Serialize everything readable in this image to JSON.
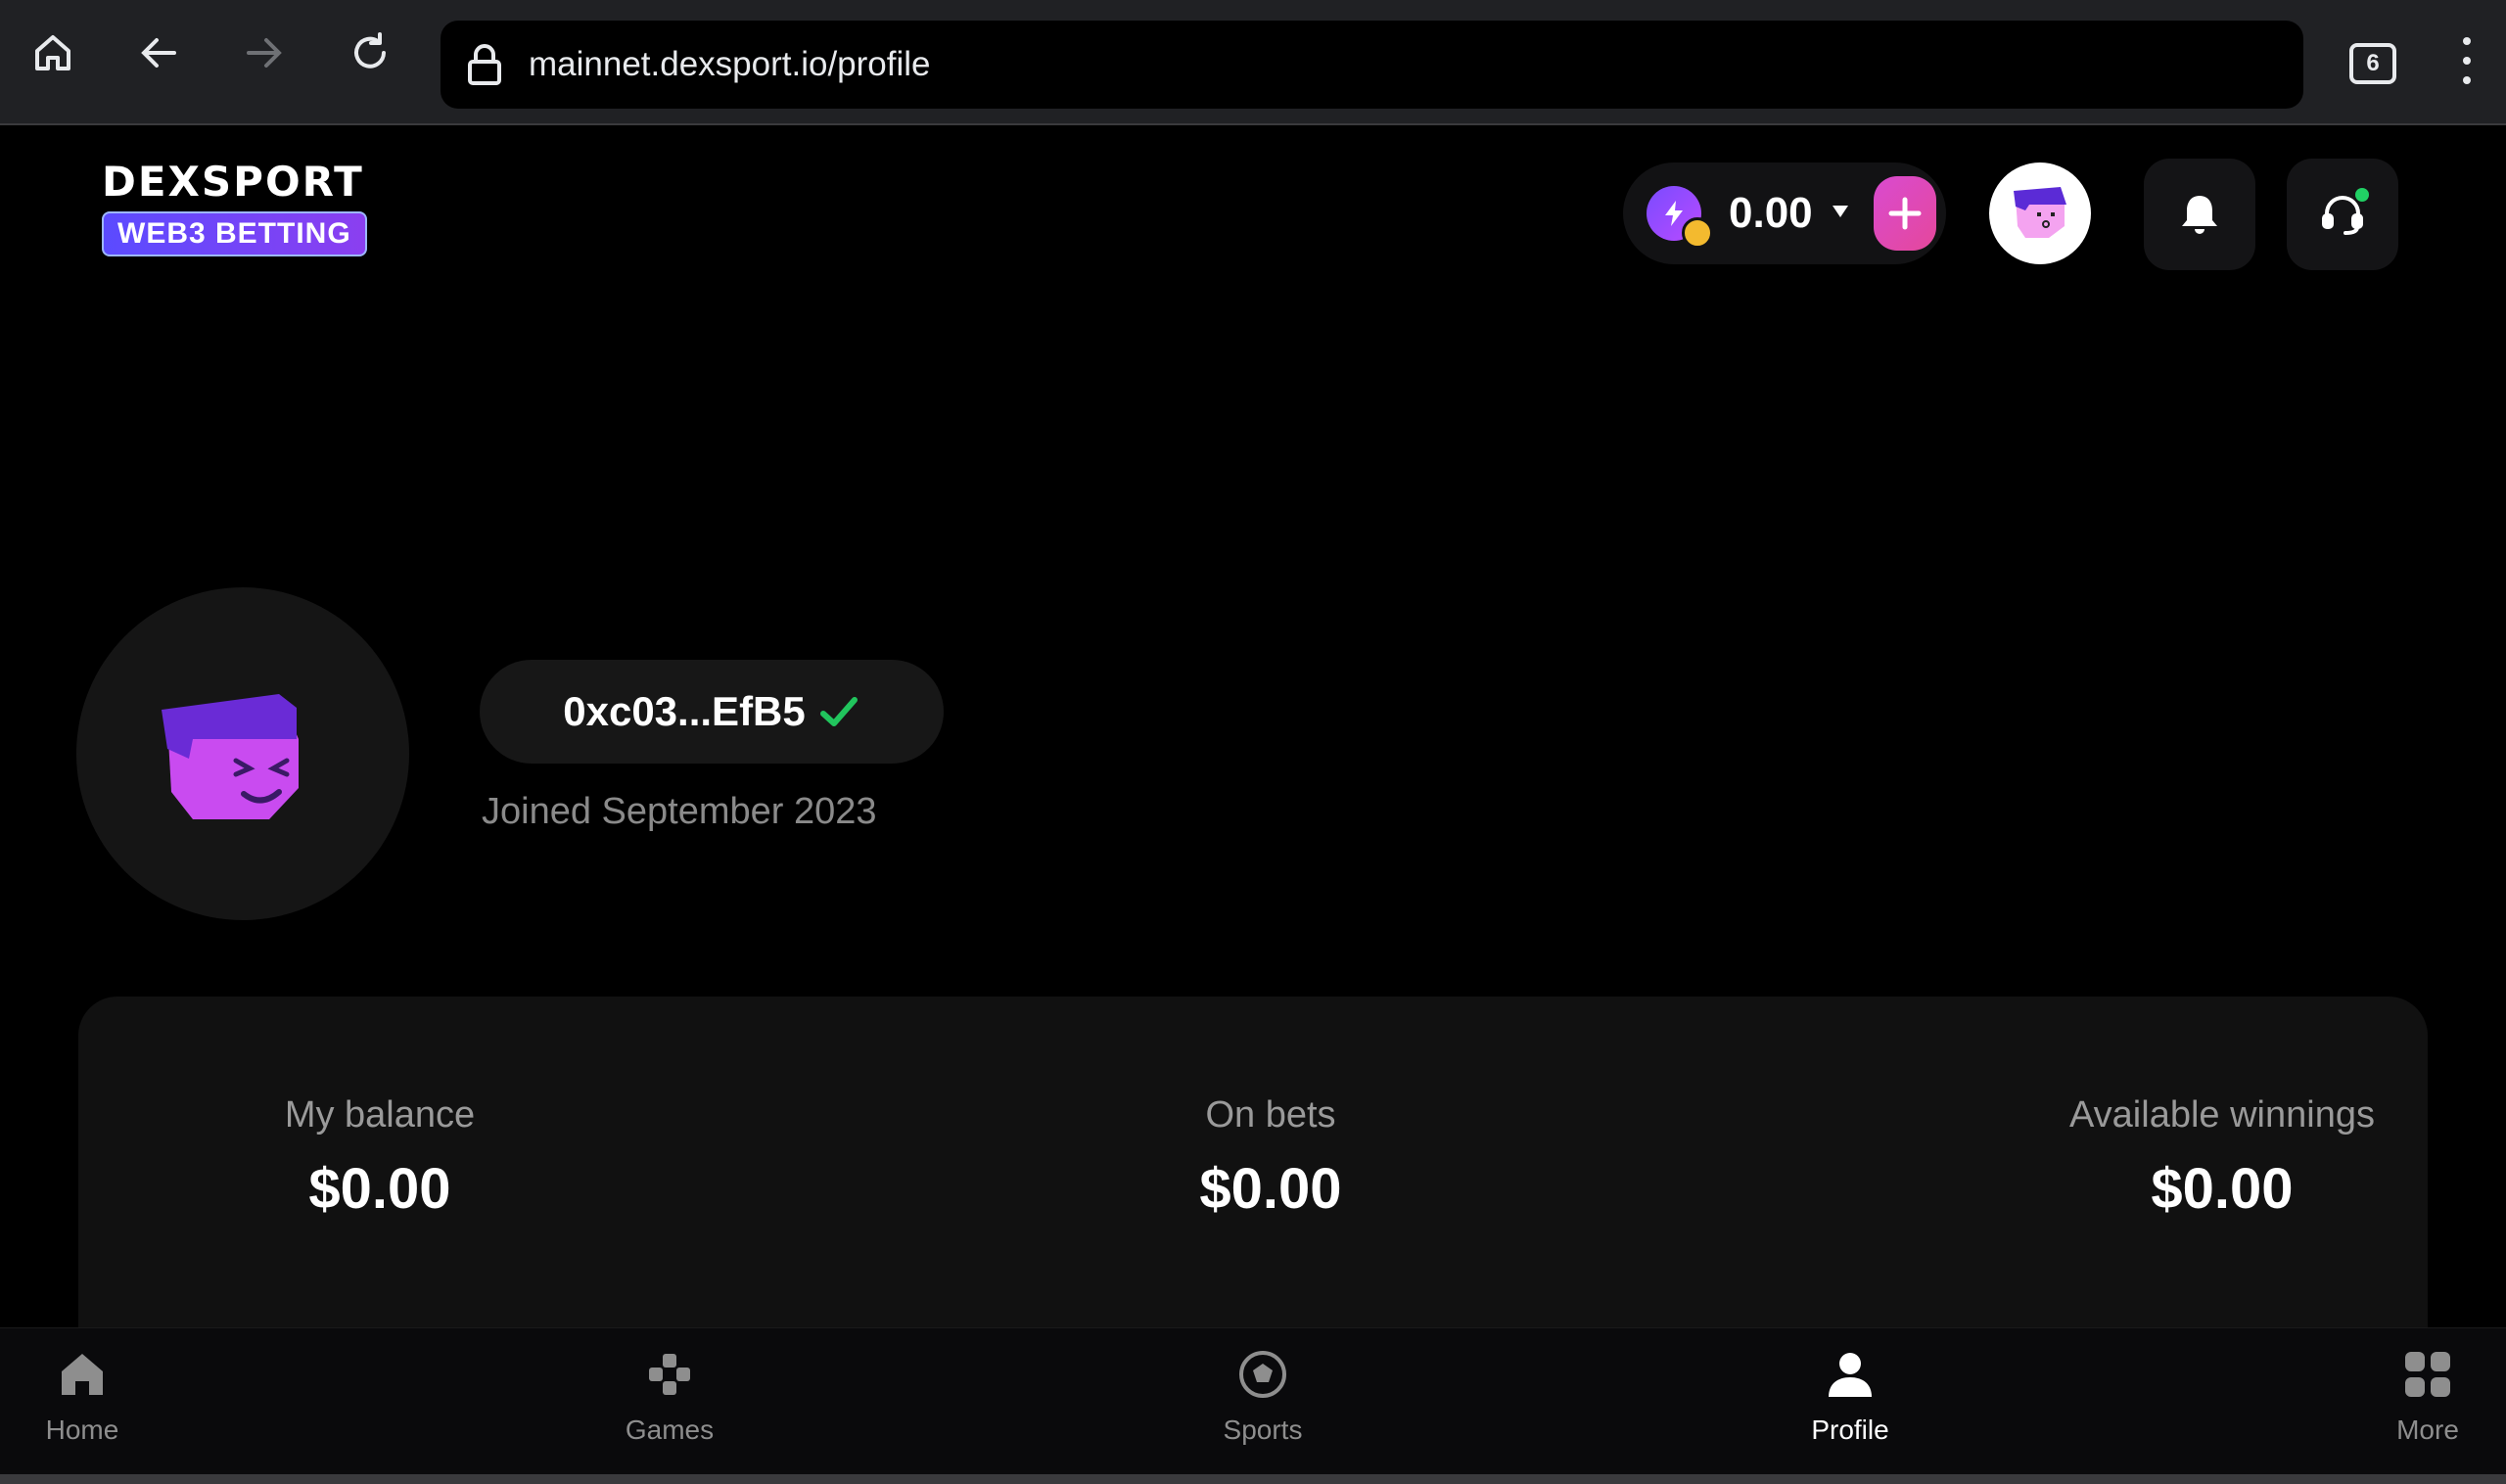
{
  "browser": {
    "url": "mainnet.dexsport.io/profile",
    "tab_count": "6",
    "icons": [
      "home-icon",
      "back-icon",
      "forward-icon",
      "reload-icon",
      "lock-icon",
      "tabs-icon",
      "menu-icon"
    ]
  },
  "header": {
    "logo_title": "DEXSPORT",
    "logo_badge": "WEB3 BETTING",
    "wallet_balance": "0.00",
    "icons": [
      "bolt-icon",
      "bnb-coin-icon",
      "chevron-down-icon",
      "plus-icon",
      "avatar",
      "bell-icon",
      "support-headset-icon"
    ]
  },
  "profile": {
    "address": "0xc03...EfB5",
    "joined": "Joined September 2023"
  },
  "balance": {
    "my_balance_label": "My balance",
    "my_balance_value": "$0.00",
    "on_bets_label": "On bets",
    "on_bets_value": "$0.00",
    "winnings_label": "Available winnings",
    "winnings_value": "$0.00"
  },
  "nav": {
    "items": [
      {
        "label": "Home",
        "icon": "home-icon"
      },
      {
        "label": "Games",
        "icon": "gamepad-icon"
      },
      {
        "label": "Sports",
        "icon": "soccer-ball-icon"
      },
      {
        "label": "Profile",
        "icon": "user-icon"
      },
      {
        "label": "More",
        "icon": "grid-icon"
      }
    ],
    "active": "Profile"
  },
  "colors": {
    "accent_purple": "#7a4bff",
    "accent_pink": "#e5489b",
    "verified_green": "#21c55d",
    "notification_dot": "#21d064"
  }
}
